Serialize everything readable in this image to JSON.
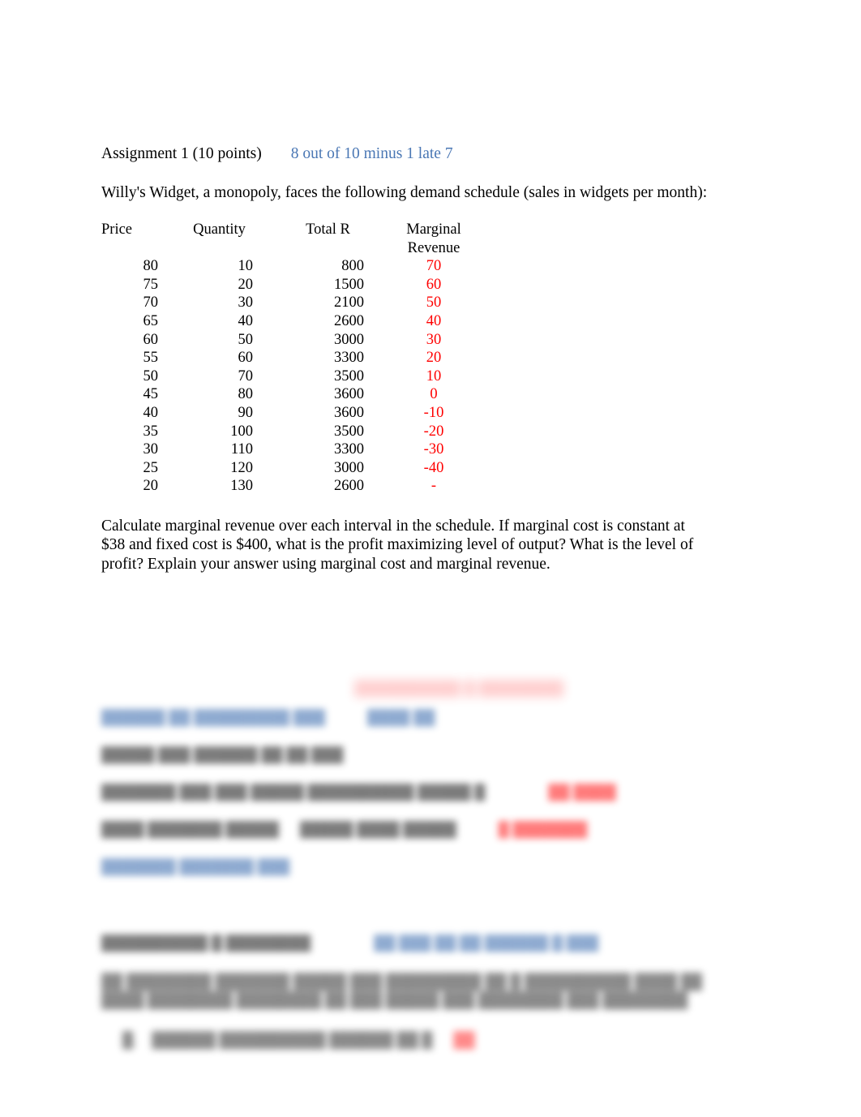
{
  "document": {
    "heading": {
      "title": "Assignment 1 (10 points)",
      "grade_note": "8 out of 10 minus 1 late 7",
      "grade_color": "#4A77B4"
    },
    "intro": "Willy's Widget, a monopoly, faces the following demand schedule (sales in widgets per month):",
    "table": {
      "columns": [
        "Price",
        "Quantity",
        "Total R",
        "Marginal Revenue"
      ],
      "marginal_revenue_color": "#FF0000",
      "rows": [
        {
          "price": "80",
          "quantity": "10",
          "total_r": "800",
          "marginal_revenue": "70"
        },
        {
          "price": "75",
          "quantity": "20",
          "total_r": "1500",
          "marginal_revenue": "60"
        },
        {
          "price": "70",
          "quantity": "30",
          "total_r": "2100",
          "marginal_revenue": "50"
        },
        {
          "price": "65",
          "quantity": "40",
          "total_r": "2600",
          "marginal_revenue": "40"
        },
        {
          "price": "60",
          "quantity": "50",
          "total_r": "3000",
          "marginal_revenue": "30"
        },
        {
          "price": "55",
          "quantity": "60",
          "total_r": "3300",
          "marginal_revenue": "20"
        },
        {
          "price": "50",
          "quantity": "70",
          "total_r": "3500",
          "marginal_revenue": "10"
        },
        {
          "price": "45",
          "quantity": "80",
          "total_r": "3600",
          "marginal_revenue": "0"
        },
        {
          "price": "40",
          "quantity": "90",
          "total_r": "3600",
          "marginal_revenue": "-10"
        },
        {
          "price": "35",
          "quantity": "100",
          "total_r": "3500",
          "marginal_revenue": "-20"
        },
        {
          "price": "30",
          "quantity": "110",
          "total_r": "3300",
          "marginal_revenue": "-30"
        },
        {
          "price": "25",
          "quantity": "120",
          "total_r": "3000",
          "marginal_revenue": "-40"
        },
        {
          "price": "20",
          "quantity": "130",
          "total_r": "2600",
          "marginal_revenue": "-"
        }
      ]
    },
    "question": "Calculate marginal revenue over each interval in the schedule. If marginal cost is constant at $38 and fixed cost is $400, what is the profit maximizing level of output? What is the level of profit? Explain your answer using marginal cost and marginal revenue.",
    "obscured_section": {
      "note": "lower portion of page is blurred and illegible",
      "line_1_blue": "██████ ██ █████████ ███",
      "line_1_blue_tail": "████ ██",
      "line_2_black": "█████ ███ ██████ ██ ██  ███",
      "line_3_black": "███████ ███ ███ █████ ██████████ █████ █",
      "line_3_red": "██ ████",
      "line_4_black_a": "████ ███████ █████",
      "line_4_black_b": "█████ ████ █████",
      "line_4_red": "█ ███████",
      "line_5_blue": "███████ ███████ ███",
      "line_6_black": "██████████ █ ████████",
      "line_6_blue": "██ ███ ██ ██ ██████  █ ███",
      "paragraph": "██ ████████ ███████ █████ ███ █████████ ██ █ ██████████ ████ ██ ████ ████████ ████████ ██ ███ █████ ███ ████████ ███ ████████",
      "list_item": "█. ██████ ██████████ ██████ ██ █",
      "list_item_red": "██"
    }
  }
}
